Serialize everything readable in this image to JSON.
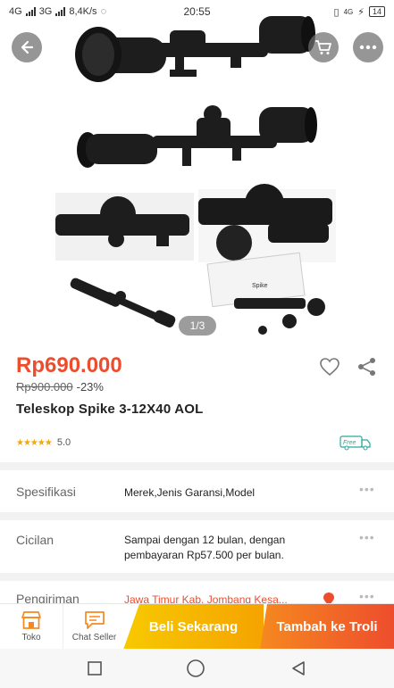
{
  "status_bar": {
    "left": "4G",
    "left2": "3G",
    "speed": "8,4K/s",
    "time": "20:55",
    "battery": "14",
    "net": "4G"
  },
  "gallery": {
    "page_indicator": "1/3",
    "brand_mark": "Spike"
  },
  "product": {
    "price": "Rp690.000",
    "old_price": "Rp900.000",
    "discount": "-23%",
    "title": "Teleskop Spike 3-12X40 AOL",
    "rating": "5.0",
    "free_badge": "Free"
  },
  "rows": {
    "spec_label": "Spesifikasi",
    "spec_value": "Merek,Jenis Garansi,Model",
    "install_label": "Cicilan",
    "install_value": "Sampai dengan 12 bulan, dengan pembayaran Rp57.500 per bulan.",
    "ship_label": "Pengiriman",
    "ship_value": "Jawa Timur Kab. Jombang Kesa..."
  },
  "bottom_bar": {
    "store_label": "Toko",
    "chat_label": "Chat Seller",
    "buy_label": "Beli Sekarang",
    "add_cart_label": "Tambah ke Troli"
  },
  "colors": {
    "accent": "#ee4d2d",
    "buy": "#f5b400",
    "star": "#f6a700",
    "free_green": "#26aa99"
  },
  "icons": [
    "back-arrow-icon",
    "cart-icon",
    "more-icon",
    "heart-icon",
    "share-icon",
    "free-shipping-icon",
    "store-icon",
    "chat-icon",
    "location-icon",
    "nav-square-icon",
    "nav-circle-icon",
    "nav-back-icon"
  ]
}
